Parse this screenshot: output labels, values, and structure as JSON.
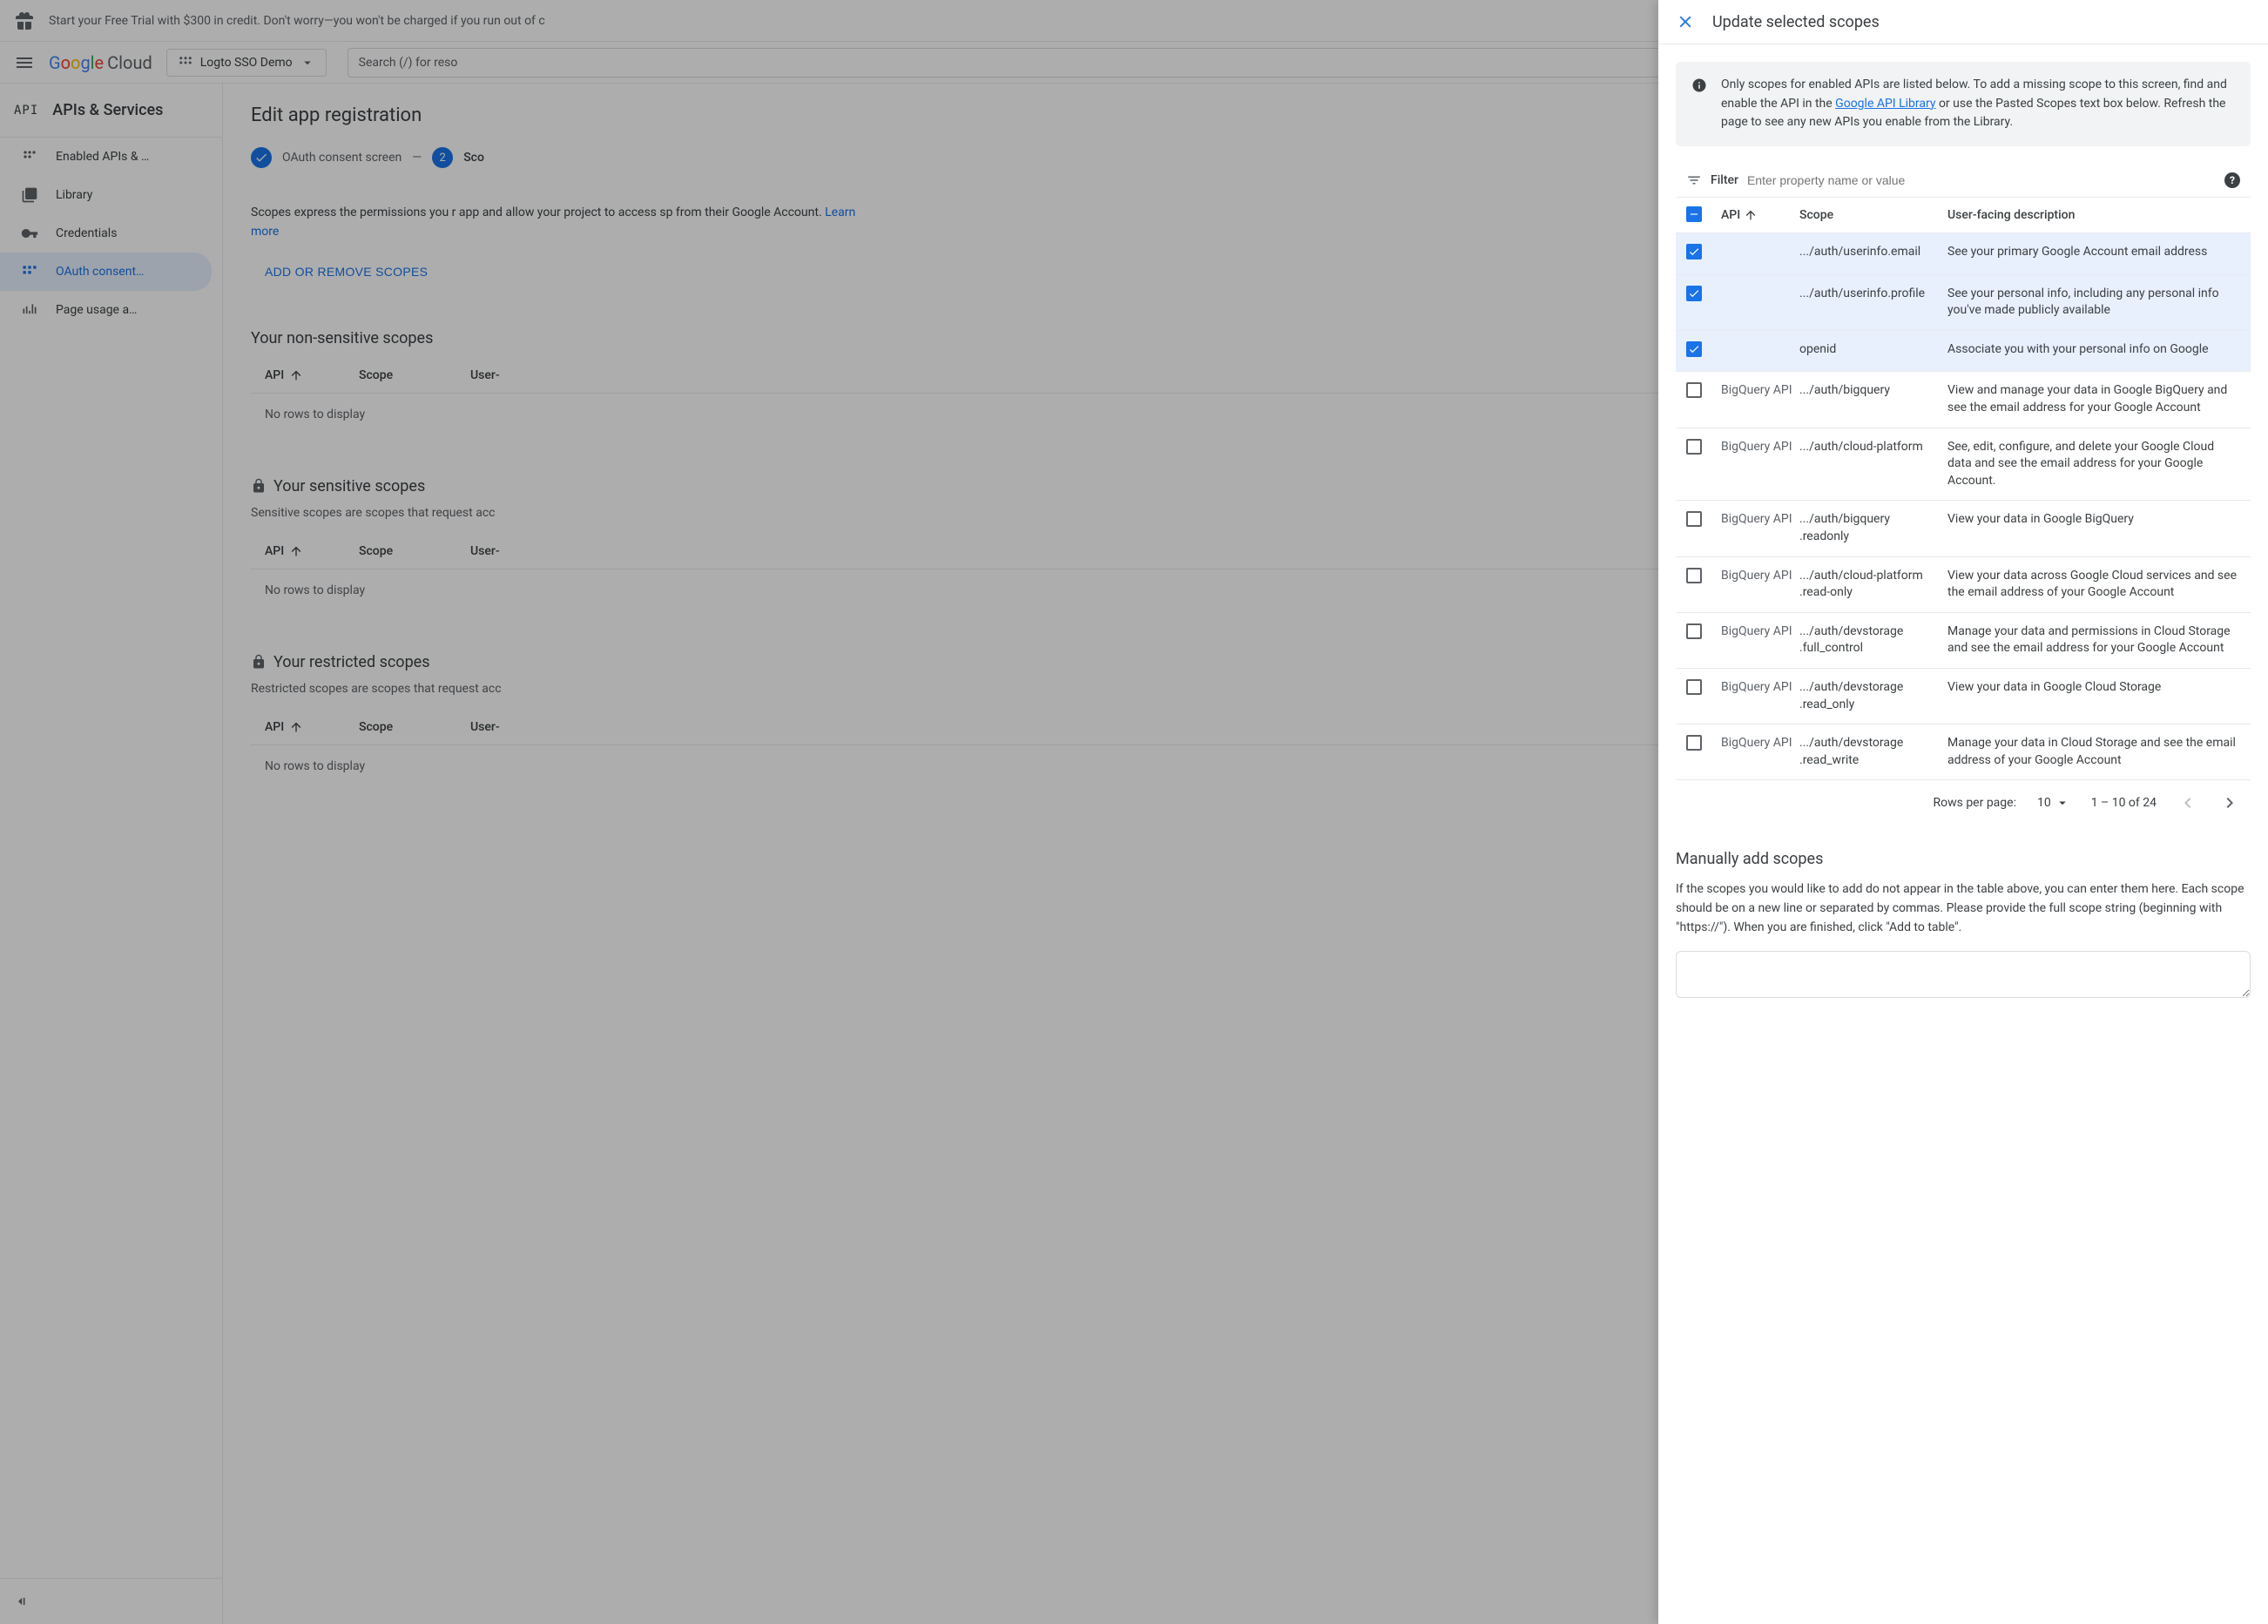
{
  "promo": {
    "text": "Start your Free Trial with $300 in credit. Don't worry—you won't be charged if you run out of c"
  },
  "header": {
    "logo_text": "Google",
    "logo_cloud": "Cloud",
    "project": "Logto SSO Demo",
    "search_placeholder": "Search (/) for reso"
  },
  "sidebar": {
    "title": "APIs & Services",
    "items": [
      {
        "label": "Enabled APIs & …"
      },
      {
        "label": "Library"
      },
      {
        "label": "Credentials"
      },
      {
        "label": "OAuth consent…"
      },
      {
        "label": "Page usage a…"
      }
    ]
  },
  "content": {
    "title": "Edit app registration",
    "stepper": {
      "step1": "OAuth consent screen",
      "step2_num": "2",
      "step2": "Sco"
    },
    "intro": "Scopes express the permissions you r app and allow your project to access sp from their Google Account. ",
    "learn_more": "Learn more",
    "add_btn": "ADD OR REMOVE SCOPES",
    "sections": [
      {
        "title": "Your non-sensitive scopes",
        "desc": ""
      },
      {
        "title": "Your sensitive scopes",
        "desc": "Sensitive scopes are scopes that request acc"
      },
      {
        "title": "Your restricted scopes",
        "desc": "Restricted scopes are scopes that request acc"
      }
    ],
    "table_headers": {
      "api": "API",
      "scope": "Scope",
      "desc": "User-"
    },
    "no_rows": "No rows to display"
  },
  "drawer": {
    "title": "Update selected scopes",
    "info_text_1": "Only scopes for enabled APIs are listed below. To add a missing scope to this screen, find and enable the API in the ",
    "info_link": "Google API Library",
    "info_text_2": " or use the Pasted Scopes text box below. Refresh the page to see any new APIs you enable from the Library.",
    "filter_label": "Filter",
    "filter_placeholder": "Enter property name or value",
    "table": {
      "headers": {
        "api": "API",
        "scope": "Scope",
        "desc": "User-facing description"
      },
      "rows": [
        {
          "checked": true,
          "api": "",
          "scope": ".../auth/userinfo.email",
          "desc": "See your primary Google Account email address"
        },
        {
          "checked": true,
          "api": "",
          "scope": ".../auth/userinfo.profile",
          "desc": "See your personal info, including any personal info you've made publicly available"
        },
        {
          "checked": true,
          "api": "",
          "scope": "openid",
          "desc": "Associate you with your personal info on Google"
        },
        {
          "checked": false,
          "api": "BigQuery API",
          "scope": ".../auth/bigquery",
          "desc": "View and manage your data in Google BigQuery and see the email address for your Google Account"
        },
        {
          "checked": false,
          "api": "BigQuery API",
          "scope": ".../auth/cloud-platform",
          "desc": "See, edit, configure, and delete your Google Cloud data and see the email address for your Google Account."
        },
        {
          "checked": false,
          "api": "BigQuery API",
          "scope": ".../auth/bigquery .readonly",
          "desc": "View your data in Google BigQuery"
        },
        {
          "checked": false,
          "api": "BigQuery API",
          "scope": ".../auth/cloud-platform .read-only",
          "desc": "View your data across Google Cloud services and see the email address of your Google Account"
        },
        {
          "checked": false,
          "api": "BigQuery API",
          "scope": ".../auth/devstorage .full_control",
          "desc": "Manage your data and permissions in Cloud Storage and see the email address for your Google Account"
        },
        {
          "checked": false,
          "api": "BigQuery API",
          "scope": ".../auth/devstorage .read_only",
          "desc": "View your data in Google Cloud Storage"
        },
        {
          "checked": false,
          "api": "BigQuery API",
          "scope": ".../auth/devstorage .read_write",
          "desc": "Manage your data in Cloud Storage and see the email address of your Google Account"
        }
      ]
    },
    "pagination": {
      "rpp_label": "Rows per page:",
      "rpp_value": "10",
      "range": "1 – 10 of 24"
    },
    "manual": {
      "title": "Manually add scopes",
      "desc": "If the scopes you would like to add do not appear in the table above, you can enter them here. Each scope should be on a new line or separated by commas. Please provide the full scope string (beginning with \"https://\"). When you are finished, click \"Add to table\"."
    }
  }
}
